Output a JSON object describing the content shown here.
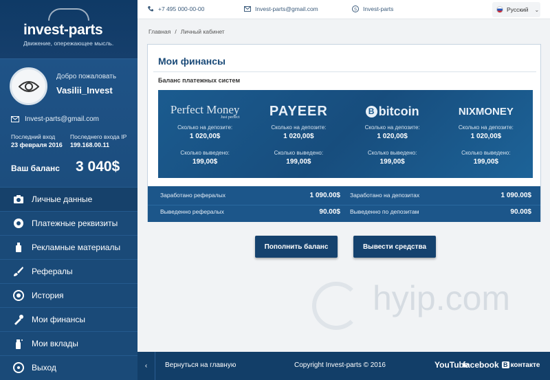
{
  "brand": {
    "title": "invest-parts",
    "tagline": "Движение, опережающее мысль."
  },
  "topbar": {
    "phone": "+7 495 000-00-00",
    "email": "Invest-parts@gmail.com",
    "skype": "Invest-parts",
    "language": "Русский"
  },
  "breadcrumb": {
    "home": "Главная",
    "separator": "/",
    "current": "Личный кабинет"
  },
  "profile": {
    "welcome": "Добро пожаловать",
    "username": "Vasilii_Invest",
    "email": "Invest-parts@gmail.com",
    "last_login_label": "Последний вход",
    "last_login_value": "23 февраля 2016",
    "last_ip_label": "Последнего входа IP",
    "last_ip_value": "199.168.00.11",
    "balance_label": "Ваш баланс",
    "balance_value": "3 040$"
  },
  "menu": [
    {
      "label": "Личные данные",
      "icon": "camera-icon"
    },
    {
      "label": "Платежные реквизиты",
      "icon": "gears-icon"
    },
    {
      "label": "Рекламные материалы",
      "icon": "bottle-icon"
    },
    {
      "label": "Рефералы",
      "icon": "brush-icon"
    },
    {
      "label": "История",
      "icon": "wheel-icon"
    },
    {
      "label": "Мои финансы",
      "icon": "wrench-icon"
    },
    {
      "label": "Мои вклады",
      "icon": "spray-icon"
    },
    {
      "label": "Выход",
      "icon": "steering-wheel-icon"
    }
  ],
  "main": {
    "title": "Мои финансы",
    "subtitle": "Баланс платежных систем",
    "systems": [
      {
        "name": "Perfect Money",
        "sub": "Just perfect",
        "deposit_label": "Сколько на депозите:",
        "deposit_value": "1 020,00$",
        "withdrawn_label": "Сколько выведено:",
        "withdrawn_value": "199,00$"
      },
      {
        "name": "PAYEER",
        "deposit_label": "Сколько на депозите:",
        "deposit_value": "1 020,00$",
        "withdrawn_label": "Сколько выведено:",
        "withdrawn_value": "199,00$"
      },
      {
        "name": "bitcoin",
        "deposit_label": "Сколько на депозите:",
        "deposit_value": "1 020,00$",
        "withdrawn_label": "Сколько выведено:",
        "withdrawn_value": "199,00$"
      },
      {
        "name": "NIXMONEY",
        "deposit_label": "Сколько на депозите:",
        "deposit_value": "1 020,00$",
        "withdrawn_label": "Сколько выведено:",
        "withdrawn_value": "199,00$"
      }
    ],
    "summary": {
      "ref_earned_label": "Заработано рефералых",
      "ref_earned_value": "1 090.00$",
      "dep_earned_label": "Заработано на депозитах",
      "dep_earned_value": "1 090.00$",
      "ref_withdrawn_label": "Выведенно рефералых",
      "ref_withdrawn_value": "90.00$",
      "dep_withdrawn_label": "Выведенно по депозитам",
      "dep_withdrawn_value": "90.00$"
    },
    "btn_topup": "Пополнить баланс",
    "btn_withdraw": "Вывести средства"
  },
  "watermark": "hyip.com",
  "footer": {
    "back": "Вернуться на главную",
    "copyright": "Copyright  Invest-parts ©  2016",
    "youtube": "YouTube",
    "facebook": "facebook",
    "vk_prefix": "B",
    "vk": "контакте"
  }
}
